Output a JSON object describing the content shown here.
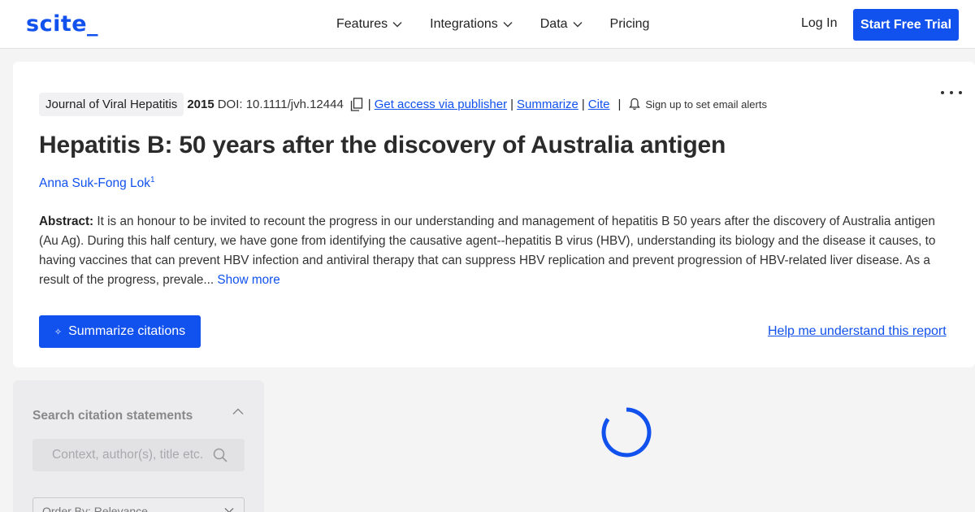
{
  "nav": {
    "logo": "scite_",
    "items": [
      {
        "label": "Features",
        "has_dropdown": true
      },
      {
        "label": "Integrations",
        "has_dropdown": true
      },
      {
        "label": "Data",
        "has_dropdown": true
      },
      {
        "label": "Pricing",
        "has_dropdown": false
      }
    ],
    "login": "Log In",
    "cta": "Start Free Trial"
  },
  "paper": {
    "journal": "Journal of Viral Hepatitis",
    "year": "2015",
    "doi": "DOI: 10.1111/jvh.12444",
    "links": {
      "access": "Get access via publisher",
      "summarize": "Summarize",
      "cite": "Cite"
    },
    "alerts": "Sign up to set email alerts",
    "title": "Hepatitis B: 50 years after the discovery of Australia antigen",
    "author": "Anna Suk-Fong Lok",
    "author_sup": "1",
    "abstract_label": "Abstract:",
    "abstract_text": " It is an honour to be invited to recount the progress in our understanding and management of hepatitis B 50 years after the discovery of Australia antigen (Au Ag). During this half century, we have gone from identifying the causative agent--hepatitis B virus (HBV), understanding its biology and the disease it causes, to having vaccines that can prevent HBV infection and antiviral therapy that can suppress HBV replication and prevent progression of HBV-related liver disease. As a result of the progress, prevale...",
    "show_more": " Show more",
    "summarize_button": "Summarize citations",
    "help_link": "Help me understand this report"
  },
  "sidebar": {
    "title": "Search citation statements",
    "search_placeholder": "Context, author(s), title etc.",
    "order_label": "Order By: Relevance"
  },
  "colors": {
    "accent": "#1151ee",
    "background": "#f4f4f5"
  }
}
